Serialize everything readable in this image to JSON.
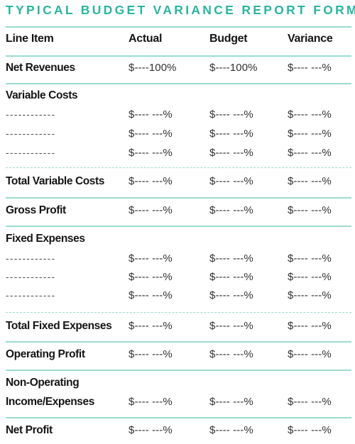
{
  "title": "TYPICAL BUDGET VARIANCE REPORT FORMAT",
  "columns": [
    "Line Item",
    "Actual",
    "Budget",
    "Variance"
  ],
  "rows": {
    "net_revenues": {
      "label": "Net Revenues",
      "actual": "$----100%",
      "budget": "$----100%",
      "variance": "$---- ---%"
    },
    "variable_costs": {
      "label": "Variable Costs"
    },
    "var_items": [
      {
        "label": "------------",
        "actual": "$---- ---%",
        "budget": "$---- ---%",
        "variance": "$---- ---%"
      },
      {
        "label": "------------",
        "actual": "$---- ---%",
        "budget": "$---- ---%",
        "variance": "$---- ---%"
      },
      {
        "label": "------------",
        "actual": "$---- ---%",
        "budget": "$---- ---%",
        "variance": "$---- ---%"
      }
    ],
    "total_variable_costs": {
      "label": "Total Variable Costs",
      "actual": "$---- ---%",
      "budget": "$---- ---%",
      "variance": "$---- ---%"
    },
    "gross_profit": {
      "label": "Gross Profit",
      "actual": "$---- ---%",
      "budget": "$---- ---%",
      "variance": "$---- ---%"
    },
    "fixed_expenses": {
      "label": "Fixed Expenses"
    },
    "fixed_items": [
      {
        "label": "------------",
        "actual": "$---- ---%",
        "budget": "$---- ---%",
        "variance": "$---- ---%"
      },
      {
        "label": "------------",
        "actual": "$---- ---%",
        "budget": "$---- ---%",
        "variance": "$---- ---%"
      },
      {
        "label": "------------",
        "actual": "$---- ---%",
        "budget": "$---- ---%",
        "variance": "$---- ---%"
      }
    ],
    "total_fixed_expenses": {
      "label": "Total Fixed Expenses",
      "actual": "$---- ---%",
      "budget": "$---- ---%",
      "variance": "$---- ---%"
    },
    "operating_profit": {
      "label": "Operating Profit",
      "actual": "$---- ---%",
      "budget": "$---- ---%",
      "variance": "$---- ---%"
    },
    "non_operating": {
      "label_line1": "Non-Operating",
      "label_line2": "Income/Expenses",
      "actual": "$---- ---%",
      "budget": "$---- ---%",
      "variance": "$---- ---%"
    },
    "net_profit": {
      "label": "Net Profit",
      "actual": "$---- ---%",
      "budget": "$---- ---%",
      "variance": "$---- ---%"
    }
  },
  "colors": {
    "accent": "#2bb59f",
    "rule": "#9adbd0",
    "text": "#151515"
  }
}
